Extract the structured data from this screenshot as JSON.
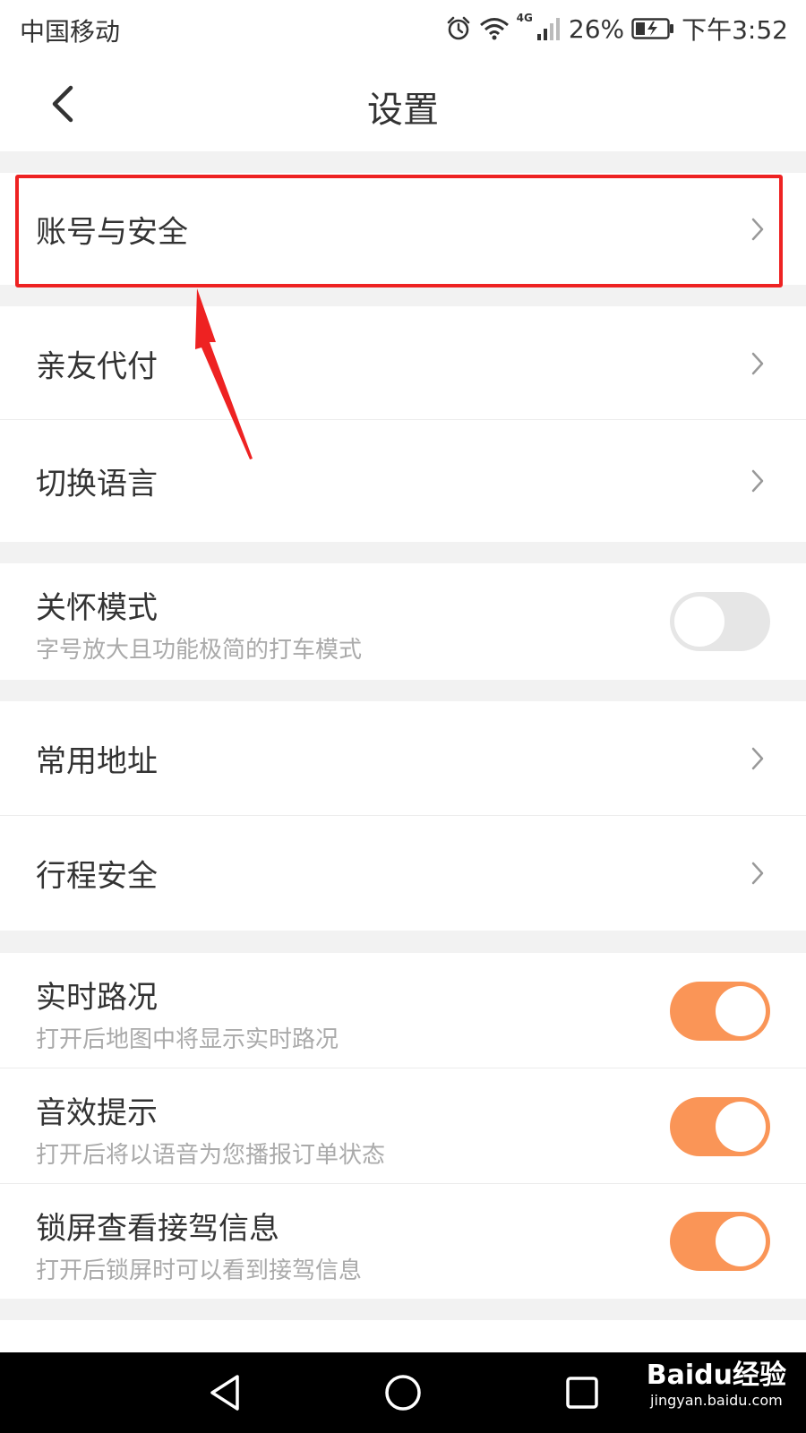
{
  "status_bar": {
    "carrier": "中国移动",
    "network_label": "4G",
    "battery_percent": "26%",
    "time": "下午3:52",
    "icons": [
      "alarm-icon",
      "wifi-icon",
      "signal-icon",
      "battery-charging-icon"
    ]
  },
  "header": {
    "title": "设置",
    "back_icon": "chevron-left-icon"
  },
  "settings": {
    "account_security": {
      "label": "账号与安全"
    },
    "family_pay": {
      "label": "亲友代付"
    },
    "switch_language": {
      "label": "切换语言"
    },
    "care_mode": {
      "label": "关怀模式",
      "description": "字号放大且功能极简的打车模式",
      "enabled": false
    },
    "common_address": {
      "label": "常用地址"
    },
    "trip_safety": {
      "label": "行程安全"
    },
    "realtime_traffic": {
      "label": "实时路况",
      "description": "打开后地图中将显示实时路况",
      "enabled": true
    },
    "sound_prompt": {
      "label": "音效提示",
      "description": "打开后将以语音为您播报订单状态",
      "enabled": true
    },
    "lockscreen_info": {
      "label": "锁屏查看接驾信息",
      "description": "打开后锁屏时可以看到接驾信息",
      "enabled": true
    }
  },
  "nav_bar": {
    "buttons": [
      "back-triangle-icon",
      "home-circle-icon",
      "recents-square-icon"
    ]
  },
  "watermark": {
    "main": "Baidu经验",
    "sub": "jingyan.baidu.com"
  },
  "colors": {
    "accent_toggle": "#fa9557",
    "highlight": "#ee2222",
    "background": "#f2f2f2"
  }
}
